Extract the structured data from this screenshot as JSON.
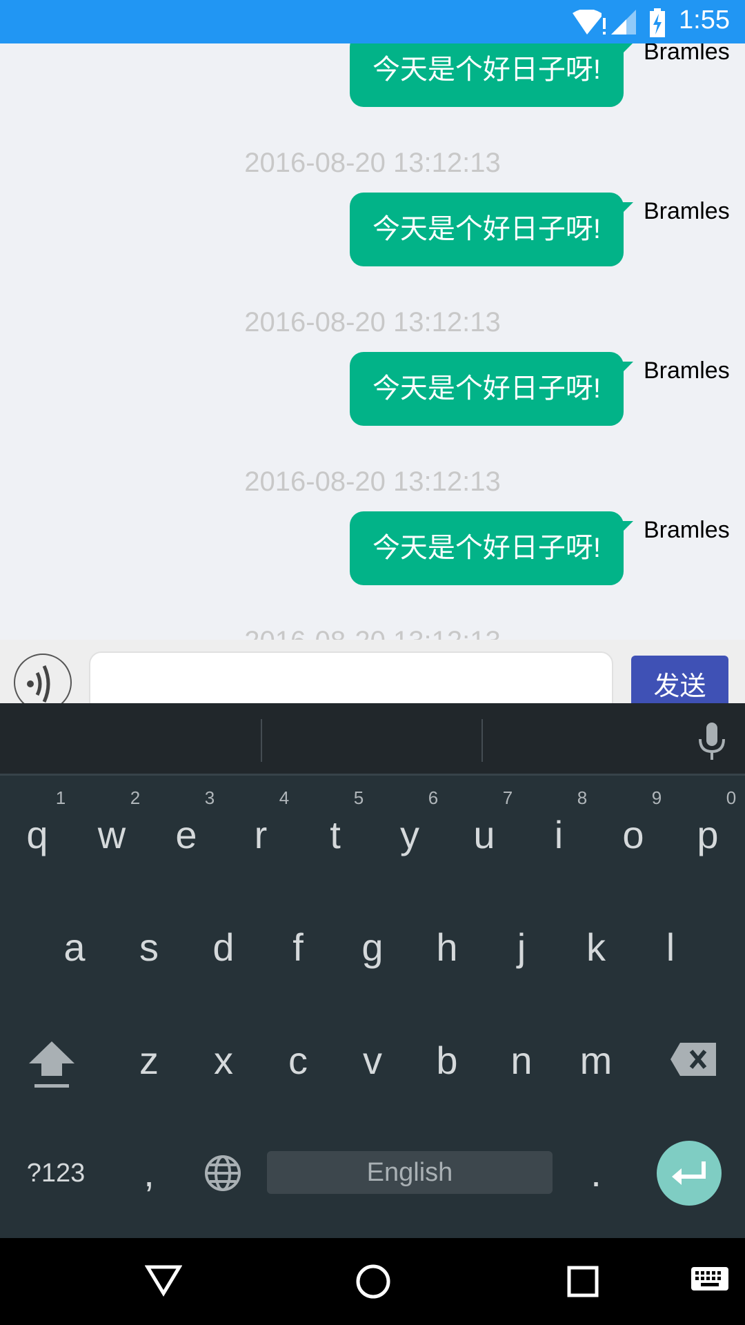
{
  "status_bar": {
    "time": "1:55",
    "icons": [
      "wifi-alert-icon",
      "signal-icon",
      "battery-charging-icon"
    ],
    "color": "#2196f3"
  },
  "messages": [
    {
      "timestamp": "",
      "text": "今天是个好日子呀!",
      "sender": "Bramles"
    },
    {
      "timestamp": "2016-08-20 13:12:13",
      "text": "今天是个好日子呀!",
      "sender": "Bramles"
    },
    {
      "timestamp": "2016-08-20 13:12:13",
      "text": "今天是个好日子呀!",
      "sender": "Bramles"
    },
    {
      "timestamp": "2016-08-20 13:12:13",
      "text": "今天是个好日子呀!",
      "sender": "Bramles"
    },
    {
      "timestamp": "2016-08-20 13:12:13"
    }
  ],
  "input_bar": {
    "value": "",
    "send_label": "发送",
    "send_color": "#3f51b5",
    "bubble_color": "#02b388"
  },
  "keyboard": {
    "row1": [
      "q",
      "w",
      "e",
      "r",
      "t",
      "y",
      "u",
      "i",
      "o",
      "p"
    ],
    "row1_hints": [
      "1",
      "2",
      "3",
      "4",
      "5",
      "6",
      "7",
      "8",
      "9",
      "0"
    ],
    "row2": [
      "a",
      "s",
      "d",
      "f",
      "g",
      "h",
      "j",
      "k",
      "l"
    ],
    "row3": [
      "z",
      "x",
      "c",
      "v",
      "b",
      "n",
      "m"
    ],
    "symbols_label": "?123",
    "comma": ",",
    "period": ".",
    "space_label": "English"
  }
}
